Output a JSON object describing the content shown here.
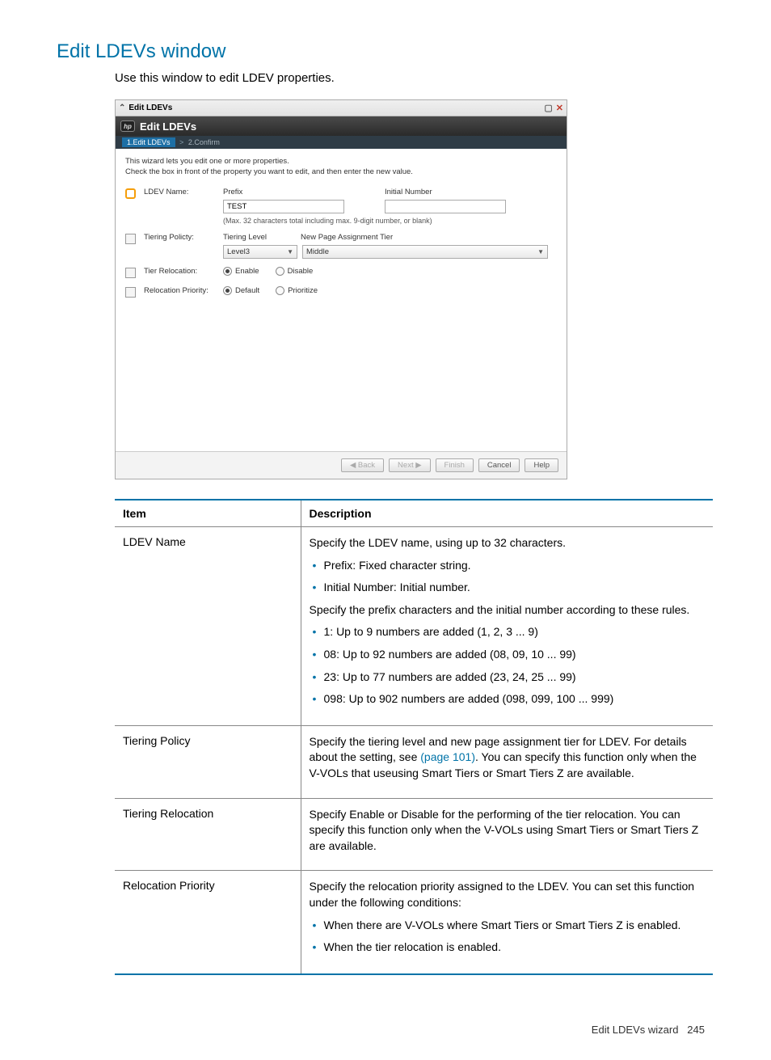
{
  "page": {
    "title": "Edit LDEVs window",
    "subtitle": "Use this window to edit LDEV properties."
  },
  "window": {
    "title_small": "Edit LDEVs",
    "header_title": "Edit LDEVs",
    "breadcrumb": {
      "step1": "1.Edit LDEVs",
      "sep": ">",
      "step2": "2.Confirm"
    },
    "intro1": "This wizard lets you edit one or more properties.",
    "intro2": "Check the box in front of the property you want to edit, and then enter the new value.",
    "fields": {
      "ldev_name": {
        "label": "LDEV Name:",
        "prefix_label": "Prefix",
        "prefix_value": "TEST",
        "initnum_label": "Initial Number",
        "initnum_value": "",
        "hint": "(Max. 32 characters total including max. 9-digit number, or blank)"
      },
      "tiering_policy": {
        "label": "Tiering Policty:",
        "level_label": "Tiering Level",
        "level_value": "Level3",
        "newpage_label": "New Page Assignment Tier",
        "newpage_value": "Middle"
      },
      "tier_relocation": {
        "label": "Tier Relocation:",
        "opt1": "Enable",
        "opt2": "Disable"
      },
      "relocation_priority": {
        "label": "Relocation Priority:",
        "opt1": "Default",
        "opt2": "Prioritize"
      }
    },
    "buttons": {
      "back": "◀ Back",
      "next": "Next ▶",
      "finish": "Finish",
      "cancel": "Cancel",
      "help": "Help"
    }
  },
  "table": {
    "h1": "Item",
    "h2": "Description",
    "rows": [
      {
        "item": "LDEV Name",
        "para1": "Specify the LDEV name, using up to 32 characters.",
        "list1": [
          "Prefix: Fixed character string.",
          "Initial Number: Initial number."
        ],
        "para2": "Specify the prefix characters and the initial number according to these rules.",
        "list2": [
          "1: Up to 9 numbers are added (1, 2, 3 ... 9)",
          "08: Up to 92 numbers are added (08, 09, 10 ... 99)",
          "23: Up to 77 numbers are added (23, 24, 25 ... 99)",
          "098: Up to 902 numbers are added (098, 099, 100 ... 999)"
        ]
      },
      {
        "item": "Tiering Policy",
        "para1a": "Specify the tiering level and new page assignment tier for LDEV. For details about the setting, see ",
        "link": "(page 101)",
        "para1b": ". You can specify this function only when the V-VOLs that useusing Smart Tiers or Smart Tiers Z are available."
      },
      {
        "item": "Tiering Relocation",
        "para1": "Specify Enable or Disable for the performing of the tier relocation. You can specify this function only when the V-VOLs using Smart Tiers or Smart Tiers Z are available."
      },
      {
        "item": "Relocation Priority",
        "para1": "Specify the relocation priority assigned to the LDEV. You can set this function under the following conditions:",
        "list1": [
          "When there are V-VOLs where Smart Tiers or Smart Tiers Z is enabled.",
          "When the tier relocation is enabled."
        ]
      }
    ]
  },
  "footer": {
    "text": "Edit LDEVs wizard",
    "page": "245"
  }
}
